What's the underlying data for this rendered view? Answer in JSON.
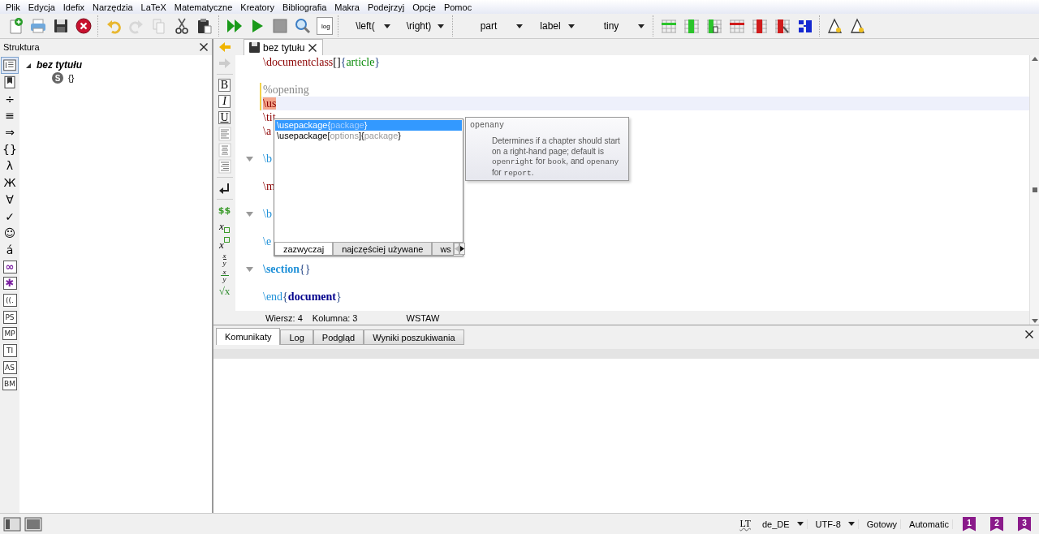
{
  "menu": [
    "Plik",
    "Edycja",
    "Idefix",
    "Narzędzia",
    "LaTeX",
    "Matematyczne",
    "Kreatory",
    "Bibliografia",
    "Makra",
    "Podejrzyj",
    "Opcje",
    "Pomoc"
  ],
  "toolbar": [
    [
      {
        "kind": "new",
        "disabled": false
      },
      {
        "kind": "print",
        "disabled": false
      },
      {
        "kind": "save",
        "disabled": false
      },
      {
        "kind": "close",
        "disabled": false
      }
    ],
    [
      {
        "kind": "undo",
        "disabled": false
      },
      {
        "kind": "redo",
        "disabled": true
      },
      {
        "kind": "copy",
        "disabled": true
      },
      {
        "kind": "cut",
        "disabled": false
      },
      {
        "kind": "paste",
        "disabled": false
      }
    ],
    [
      {
        "kind": "quickbuild",
        "disabled": false
      },
      {
        "kind": "compile",
        "disabled": false
      },
      {
        "kind": "stop",
        "disabled": false
      },
      {
        "kind": "view",
        "disabled": false
      },
      {
        "kind": "log",
        "label": "log",
        "disabled": false
      }
    ],
    [
      {
        "kind": "dropdown",
        "label": "\\left(",
        "disabled": false
      },
      {
        "kind": "dropdown",
        "label": "\\right)",
        "disabled": false
      }
    ],
    [
      {
        "kind": "dropdown",
        "label": "part",
        "disabled": false
      },
      {
        "kind": "dropdown",
        "label": "label",
        "disabled": false
      },
      {
        "kind": "dropdown",
        "label": "tiny",
        "disabled": false
      }
    ],
    [
      {
        "kind": "add-row",
        "disabled": false
      },
      {
        "kind": "add-column",
        "disabled": false
      },
      {
        "kind": "insert-column",
        "disabled": false
      },
      {
        "kind": "remove-row",
        "disabled": false
      },
      {
        "kind": "remove-column",
        "disabled": false
      },
      {
        "kind": "cut-column",
        "disabled": false
      },
      {
        "kind": "split",
        "disabled": false
      }
    ],
    [
      {
        "kind": "triangle",
        "disabled": false
      },
      {
        "kind": "triangle",
        "disabled": false
      }
    ]
  ],
  "structure": {
    "title": "Struktura",
    "tools": [
      {
        "kind": "outline",
        "selected": true
      },
      {
        "kind": "bookmark",
        "selected": false
      },
      {
        "kind": "glyph",
        "text": "÷",
        "selected": false
      },
      {
        "kind": "glyph",
        "text": "≡",
        "selected": false
      },
      {
        "kind": "glyph",
        "text": "⇒",
        "selected": false
      },
      {
        "kind": "glyph",
        "text": "{}",
        "selected": false
      },
      {
        "kind": "glyph",
        "text": "λ",
        "selected": false
      },
      {
        "kind": "glyph",
        "text": "Ж",
        "selected": false
      },
      {
        "kind": "glyph",
        "text": "∀",
        "selected": false
      },
      {
        "kind": "glyph",
        "text": "✓",
        "selected": false
      },
      {
        "kind": "glyph",
        "text": "☺",
        "selected": false
      },
      {
        "kind": "glyph",
        "text": "á",
        "selected": false
      },
      {
        "kind": "boxed",
        "text": "∞",
        "color": "#7a1fa0",
        "selected": false
      },
      {
        "kind": "boxed",
        "text": "✱",
        "color": "#7a1fa0",
        "selected": false
      },
      {
        "kind": "boxed",
        "text": "((.",
        "selected": false
      },
      {
        "kind": "boxed",
        "text": "PS",
        "selected": false
      },
      {
        "kind": "boxed",
        "text": "MP",
        "selected": false
      },
      {
        "kind": "boxed",
        "text": "TI",
        "selected": false
      },
      {
        "kind": "boxed",
        "text": "AS",
        "selected": false
      },
      {
        "kind": "boxed",
        "text": "BM",
        "selected": false
      }
    ],
    "tree": [
      {
        "label": "bez tytułu",
        "expanded": true,
        "children": [
          {
            "badge": "S",
            "label": "{}"
          }
        ]
      }
    ]
  },
  "editor": {
    "tab": {
      "title": "bez tytułu",
      "selected": true
    },
    "gutter": [
      {
        "kind": "back",
        "disabled": false
      },
      {
        "kind": "forward",
        "disabled": true
      },
      {
        "kind": "separator"
      },
      {
        "kind": "bold",
        "text": "B"
      },
      {
        "kind": "italic",
        "text": "I"
      },
      {
        "kind": "underline",
        "text": "U"
      },
      {
        "kind": "align-left"
      },
      {
        "kind": "align-center"
      },
      {
        "kind": "align-right"
      },
      {
        "kind": "separator"
      },
      {
        "kind": "return"
      },
      {
        "kind": "separator"
      },
      {
        "kind": "math",
        "text": "$$"
      },
      {
        "kind": "sub",
        "text": "x"
      },
      {
        "kind": "sup",
        "text": "x"
      },
      {
        "kind": "frac",
        "num": "x",
        "den": "y"
      },
      {
        "kind": "dfrac",
        "num": "x",
        "den": "y"
      },
      {
        "kind": "sqrt",
        "text": "√x"
      }
    ],
    "lines": [
      {
        "foldable": false,
        "modified": false,
        "current": false,
        "segments": [
          {
            "text": "\\documentclass",
            "kind": "cmd"
          },
          {
            "text": "[]",
            "kind": "plain"
          },
          {
            "text": "{",
            "kind": "brace"
          },
          {
            "text": "article",
            "kind": "arg"
          },
          {
            "text": "}",
            "kind": "brace"
          }
        ]
      },
      {
        "foldable": false,
        "modified": false,
        "current": false
      },
      {
        "foldable": false,
        "modified": true,
        "current": false,
        "segments": [
          {
            "text": "%opening",
            "kind": "comment"
          }
        ]
      },
      {
        "foldable": false,
        "modified": true,
        "current": true,
        "segments": [
          {
            "text": "\\us",
            "kind": "typed"
          }
        ]
      },
      {
        "foldable": false,
        "modified": false,
        "current": false,
        "segments": [
          {
            "text": "\\tit",
            "kind": "cmd"
          }
        ]
      },
      {
        "foldable": false,
        "modified": false,
        "current": false,
        "segments": [
          {
            "text": "\\a",
            "kind": "cmd"
          }
        ]
      },
      {
        "foldable": false,
        "modified": false,
        "current": false
      },
      {
        "foldable": true,
        "modified": false,
        "current": false,
        "segments": [
          {
            "text": "\\b",
            "kind": "keyword"
          }
        ]
      },
      {
        "foldable": false,
        "modified": false,
        "current": false
      },
      {
        "foldable": false,
        "modified": false,
        "current": false,
        "segments": [
          {
            "text": "\\m",
            "kind": "cmd"
          }
        ]
      },
      {
        "foldable": false,
        "modified": false,
        "current": false
      },
      {
        "foldable": true,
        "modified": false,
        "current": false,
        "segments": [
          {
            "text": "\\b",
            "kind": "keyword"
          }
        ]
      },
      {
        "foldable": false,
        "modified": false,
        "current": false
      },
      {
        "foldable": false,
        "modified": false,
        "current": false,
        "segments": [
          {
            "text": "\\e",
            "kind": "keyword"
          }
        ]
      },
      {
        "foldable": false,
        "modified": false,
        "current": false
      },
      {
        "foldable": true,
        "modified": false,
        "current": false,
        "segments": [
          {
            "text": "\\section",
            "kind": "section"
          },
          {
            "text": "{}",
            "kind": "brace"
          }
        ]
      },
      {
        "foldable": false,
        "modified": false,
        "current": false
      },
      {
        "foldable": false,
        "modified": false,
        "current": false,
        "segments": [
          {
            "text": "\\end",
            "kind": "keyword"
          },
          {
            "text": "{",
            "kind": "brace"
          },
          {
            "text": "document",
            "kind": "env"
          },
          {
            "text": "}",
            "kind": "brace"
          }
        ]
      }
    ],
    "completion": {
      "items": [
        {
          "selected": true,
          "segments": [
            {
              "text": "\\usepackage{",
              "kind": "cmd"
            },
            {
              "text": "package",
              "kind": "arg"
            },
            {
              "text": "}",
              "kind": "cmd"
            }
          ]
        },
        {
          "selected": false,
          "segments": [
            {
              "text": "\\usepackage[",
              "kind": "cmd"
            },
            {
              "text": "options",
              "kind": "arg"
            },
            {
              "text": "]{",
              "kind": "cmd"
            },
            {
              "text": "package",
              "kind": "arg"
            },
            {
              "text": "}",
              "kind": "cmd"
            }
          ]
        }
      ],
      "tabs": [
        {
          "label": "zazwyczaj",
          "selected": true
        },
        {
          "label": "najczęściej używane",
          "selected": false
        },
        {
          "label": "ws",
          "selected": false
        }
      ]
    },
    "tooltip": {
      "title": "openany",
      "segments": [
        {
          "text": "Determines if a chapter should start on a right-hand page; default is ",
          "kind": "text"
        },
        {
          "text": "openright",
          "kind": "code"
        },
        {
          "text": " for ",
          "kind": "text"
        },
        {
          "text": "book",
          "kind": "code"
        },
        {
          "text": ", and ",
          "kind": "text"
        },
        {
          "text": "openany",
          "kind": "code"
        },
        {
          "text": " for ",
          "kind": "text"
        },
        {
          "text": "report",
          "kind": "code"
        },
        {
          "text": ".",
          "kind": "text"
        }
      ]
    },
    "status": [
      "Wiersz: 4",
      "Kolumna: 3",
      "WSTAW"
    ]
  },
  "messages": {
    "tabs": [
      {
        "label": "Komunikaty",
        "selected": true
      },
      {
        "label": "Log",
        "selected": false
      },
      {
        "label": "Podgląd",
        "selected": false
      },
      {
        "label": "Wyniki poszukiwania",
        "selected": false
      }
    ]
  },
  "status_bar": {
    "spell": "LT",
    "language": "de_DE",
    "encoding": "UTF-8",
    "state": "Gotowy",
    "mode": "Automatic",
    "bookmarks": [
      "1",
      "2",
      "3"
    ]
  }
}
